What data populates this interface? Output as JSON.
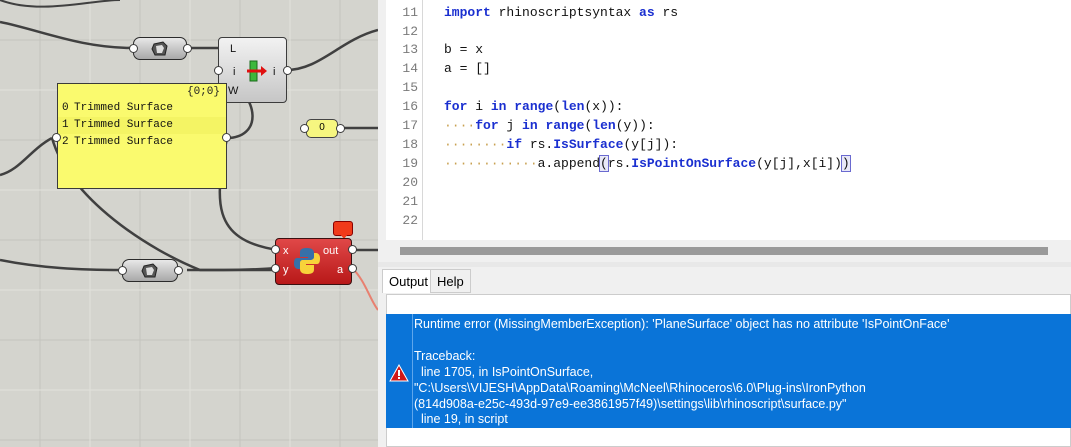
{
  "canvas": {
    "list_inputs": {
      "l": "L",
      "i": "i",
      "w": "W",
      "out": "i"
    },
    "panel": {
      "path": "{0;0}",
      "rows": [
        {
          "index": "0",
          "text": "Trimmed Surface"
        },
        {
          "index": "1",
          "text": "Trimmed Surface"
        },
        {
          "index": "2",
          "text": "Trimmed Surface"
        }
      ]
    },
    "number_value": "0",
    "python": {
      "in_x": "x",
      "in_y": "y",
      "out_out": "out",
      "out_a": "a"
    }
  },
  "editor": {
    "line_numbers": [
      "11",
      "12",
      "13",
      "14",
      "15",
      "16",
      "17",
      "18",
      "19",
      "20",
      "21",
      "22"
    ],
    "code": {
      "l11_kw": "import",
      "l11_rest": " rhinoscriptsyntax ",
      "l11_kw2": "as",
      "l11_rest2": " rs",
      "l13": "b = x",
      "l14": "a = []",
      "l16_kw": "for",
      "l16_a": " i ",
      "l16_kw2": "in",
      "l16_b": " ",
      "l16_kw3": "range",
      "l16_c": "(",
      "l16_kw4": "len",
      "l16_d": "(x)):",
      "l17_dots": "····",
      "l17_kw": "for",
      "l17_a": " j ",
      "l17_kw2": "in",
      "l17_b": " ",
      "l17_kw3": "range",
      "l17_c": "(",
      "l17_kw4": "len",
      "l17_d": "(y)):",
      "l18_dots": "········",
      "l18_kw": "if",
      "l18_a": " rs.",
      "l18_kw2": "IsSurface",
      "l18_b": "(y[j]):",
      "l19_dots": "············",
      "l19_a": "a.append",
      "l19_b": "(",
      "l19_c": "rs.",
      "l19_kw": "IsPointOnSurface",
      "l19_d": "(y[j],x[i])",
      "l19_e": ")"
    },
    "tabs": {
      "output": "Output",
      "help": "Help"
    },
    "error_lines": [
      "Runtime error (MissingMemberException): 'PlaneSurface' object has no attribute 'IsPointOnFace'",
      "",
      "Traceback:",
      "  line 1705, in IsPointOnSurface,",
      "\"C:\\Users\\VIJESH\\AppData\\Roaming\\McNeel\\Rhinoceros\\6.0\\Plug-ins\\IronPython",
      "(814d908a-e25c-493d-97e9-ee3861957f49)\\settings\\lib\\rhinoscript\\surface.py\"",
      "  line 19, in script"
    ]
  },
  "colors": {
    "error_bg": "#0a74d8",
    "keyword": "#1a2fd0",
    "panel_bg": "#fafa6e",
    "python_comp": "#c82020"
  },
  "icons": {
    "error": "error-triangle-icon",
    "param": "surface-param-icon",
    "python": "python-logo-icon"
  }
}
